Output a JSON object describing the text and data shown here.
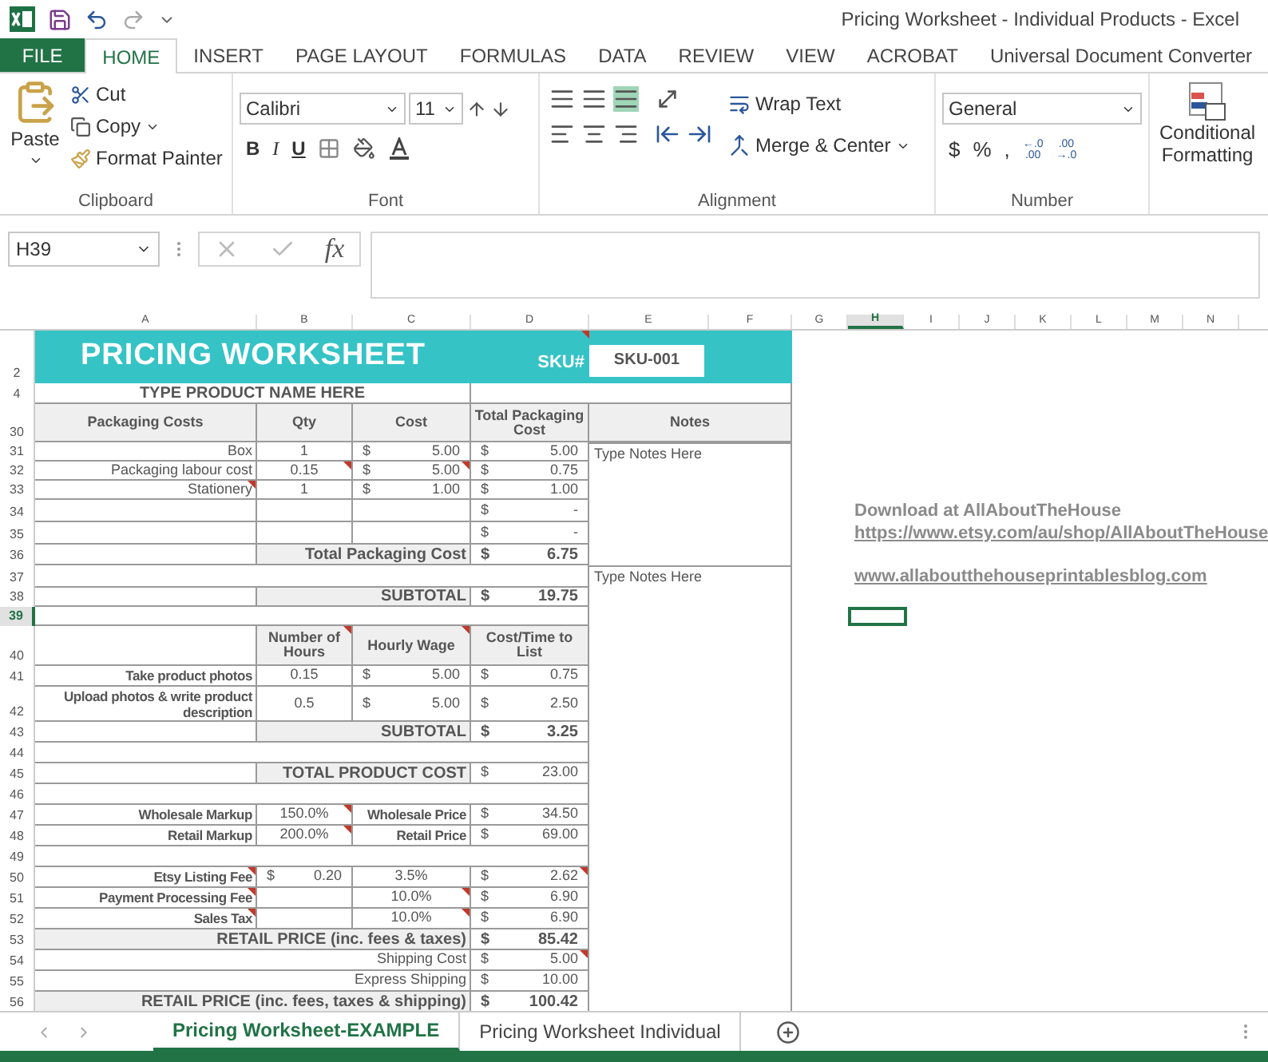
{
  "window": {
    "title": "Pricing Worksheet - Individual Products - Excel"
  },
  "ribbon_tabs": [
    {
      "label": "FILE",
      "kind": "file",
      "selected": false
    },
    {
      "label": "HOME",
      "kind": "tab",
      "selected": true
    },
    {
      "label": "INSERT",
      "kind": "tab",
      "selected": false
    },
    {
      "label": "PAGE LAYOUT",
      "kind": "tab",
      "selected": false
    },
    {
      "label": "FORMULAS",
      "kind": "tab",
      "selected": false
    },
    {
      "label": "DATA",
      "kind": "tab",
      "selected": false
    },
    {
      "label": "REVIEW",
      "kind": "tab",
      "selected": false
    },
    {
      "label": "VIEW",
      "kind": "tab",
      "selected": false
    },
    {
      "label": "ACROBAT",
      "kind": "tab",
      "selected": false
    },
    {
      "label": "Universal Document Converter",
      "kind": "tab",
      "selected": false
    }
  ],
  "clipboard": {
    "paste": "Paste",
    "cut": "Cut",
    "copy": "Copy",
    "format_painter": "Format Painter",
    "group": "Clipboard"
  },
  "font": {
    "name": "Calibri",
    "size": "11",
    "bold": "B",
    "italic": "I",
    "underline": "U",
    "group": "Font"
  },
  "alignment": {
    "wrap_text": "Wrap Text",
    "merge": "Merge & Center",
    "group": "Alignment"
  },
  "number": {
    "format": "General",
    "buttons": [
      "$",
      "%",
      ","
    ],
    "decimals": [
      {
        "top": "←.0",
        "bottom": ".00"
      },
      {
        "top": ".00",
        "bottom": "→.0"
      }
    ],
    "group": "Number"
  },
  "styles": {
    "conditional": "Conditional",
    "formatting": "Formatting"
  },
  "formula_bar": {
    "name_box": "H39",
    "fx": "fx"
  },
  "columns": [
    {
      "label": "A",
      "selected": false
    },
    {
      "label": "B",
      "selected": false
    },
    {
      "label": "C",
      "selected": false
    },
    {
      "label": "D",
      "selected": false
    },
    {
      "label": "E",
      "selected": false
    },
    {
      "label": "F",
      "selected": false
    },
    {
      "label": "G",
      "selected": false
    },
    {
      "label": "H",
      "selected": true
    },
    {
      "label": "I",
      "selected": false
    },
    {
      "label": "J",
      "selected": false
    },
    {
      "label": "K",
      "selected": false
    },
    {
      "label": "L",
      "selected": false
    },
    {
      "label": "M",
      "selected": false
    },
    {
      "label": "N",
      "selected": false
    }
  ],
  "rows": [
    {
      "num": "2",
      "selected": false,
      "cells": [
        {
          "kind": "title",
          "text": "PRICING WORKSHEET"
        },
        {
          "kind": "sku-label",
          "text": "SKU#",
          "comment": true
        },
        {
          "kind": "sku-box",
          "text": "SKU-001"
        },
        {
          "kind": "band"
        }
      ]
    },
    {
      "num": "4",
      "selected": false,
      "cells": [
        {
          "kind": "product",
          "text": "TYPE PRODUCT NAME HERE"
        },
        {
          "kind": "blank"
        }
      ]
    },
    {
      "num": "30",
      "selected": false,
      "cells": [
        {
          "kind": "header",
          "text": "Packaging Costs"
        },
        {
          "kind": "header",
          "text": "Qty"
        },
        {
          "kind": "header",
          "text": "Cost"
        },
        {
          "kind": "header",
          "text": "Total Packaging Cost"
        },
        {
          "kind": "header",
          "text": "Notes"
        }
      ]
    },
    {
      "num": "31",
      "selected": false,
      "cells": [
        {
          "kind": "label",
          "text": "Box"
        },
        {
          "kind": "value",
          "text": "1"
        },
        {
          "kind": "money",
          "dollar": "$",
          "text": "5.00"
        },
        {
          "kind": "money",
          "dollar": "$",
          "text": "5.00"
        },
        {
          "kind": "note",
          "text": "Type Notes Here"
        }
      ]
    },
    {
      "num": "32",
      "selected": false,
      "cells": [
        {
          "kind": "label",
          "text": "Packaging labour cost"
        },
        {
          "kind": "value",
          "text": "0.15",
          "comment": true
        },
        {
          "kind": "money",
          "dollar": "$",
          "text": "5.00",
          "comment": true
        },
        {
          "kind": "money",
          "dollar": "$",
          "text": "0.75"
        },
        {
          "kind": "notes-empty"
        }
      ]
    },
    {
      "num": "33",
      "selected": false,
      "cells": [
        {
          "kind": "label",
          "text": "Stationery",
          "comment": true
        },
        {
          "kind": "value",
          "text": "1"
        },
        {
          "kind": "money",
          "dollar": "$",
          "text": "1.00"
        },
        {
          "kind": "money",
          "dollar": "$",
          "text": "1.00"
        },
        {
          "kind": "notes-empty"
        }
      ]
    },
    {
      "num": "34",
      "selected": false,
      "side": {
        "kind": "text",
        "text": "Download at AllAboutTheHouse"
      },
      "cells": [
        {
          "kind": "blank"
        },
        {
          "kind": "blank"
        },
        {
          "kind": "blank"
        },
        {
          "kind": "money",
          "dollar": "$",
          "text": "-"
        },
        {
          "kind": "notes-empty"
        }
      ]
    },
    {
      "num": "35",
      "selected": false,
      "side": {
        "kind": "link",
        "text": "https://www.etsy.com/au/shop/AllAboutTheHouse"
      },
      "cells": [
        {
          "kind": "blank"
        },
        {
          "kind": "blank"
        },
        {
          "kind": "blank"
        },
        {
          "kind": "money",
          "dollar": "$",
          "text": "-"
        },
        {
          "kind": "notes-empty"
        }
      ]
    },
    {
      "num": "36",
      "selected": false,
      "cells": [
        {
          "kind": "blank"
        },
        {
          "kind": "total",
          "text": "Total Packaging Cost"
        },
        {
          "kind": "money-bold",
          "dollar": "$",
          "text": "6.75"
        },
        {
          "kind": "notes-empty"
        }
      ]
    },
    {
      "num": "37",
      "selected": false,
      "side": {
        "kind": "link",
        "text": "www.allaboutthehouseprintablesblog.com"
      },
      "cells": [
        {
          "kind": "blank"
        },
        {
          "kind": "note",
          "text": "Type Notes Here"
        }
      ]
    },
    {
      "num": "38",
      "selected": false,
      "cells": [
        {
          "kind": "blank"
        },
        {
          "kind": "total",
          "text": "SUBTOTAL"
        },
        {
          "kind": "money-bold",
          "dollar": "$",
          "text": "19.75"
        },
        {
          "kind": "notes-empty"
        }
      ]
    },
    {
      "num": "39",
      "selected": true,
      "cells": [
        {
          "kind": "blank"
        },
        {
          "kind": "notes-empty"
        }
      ]
    },
    {
      "num": "40",
      "selected": false,
      "cells": [
        {
          "kind": "blank"
        },
        {
          "kind": "header",
          "text": "Number of Hours",
          "comment": true
        },
        {
          "kind": "header",
          "text": "Hourly Wage",
          "comment": true
        },
        {
          "kind": "header",
          "text": "Cost/Time to List"
        },
        {
          "kind": "notes-empty"
        }
      ]
    },
    {
      "num": "41",
      "selected": false,
      "cells": [
        {
          "kind": "bold-label",
          "text": "Take product photos"
        },
        {
          "kind": "value",
          "text": "0.15"
        },
        {
          "kind": "money",
          "dollar": "$",
          "text": "5.00"
        },
        {
          "kind": "money",
          "dollar": "$",
          "text": "0.75"
        },
        {
          "kind": "notes-empty"
        }
      ]
    },
    {
      "num": "42",
      "selected": false,
      "cells": [
        {
          "kind": "bold-label",
          "text": "Upload photos & write product description"
        },
        {
          "kind": "value",
          "text": "0.5"
        },
        {
          "kind": "money",
          "dollar": "$",
          "text": "5.00"
        },
        {
          "kind": "money",
          "dollar": "$",
          "text": "2.50"
        },
        {
          "kind": "notes-empty"
        }
      ]
    },
    {
      "num": "43",
      "selected": false,
      "cells": [
        {
          "kind": "blank"
        },
        {
          "kind": "total",
          "text": "SUBTOTAL"
        },
        {
          "kind": "money-bold",
          "dollar": "$",
          "text": "3.25"
        },
        {
          "kind": "notes-empty"
        }
      ]
    },
    {
      "num": "44",
      "selected": false,
      "cells": [
        {
          "kind": "blank"
        },
        {
          "kind": "notes-empty"
        }
      ]
    },
    {
      "num": "45",
      "selected": false,
      "cells": [
        {
          "kind": "blank"
        },
        {
          "kind": "total",
          "text": "TOTAL PRODUCT COST"
        },
        {
          "kind": "money",
          "dollar": "$",
          "text": "23.00"
        },
        {
          "kind": "notes-empty"
        }
      ]
    },
    {
      "num": "46",
      "selected": false,
      "cells": [
        {
          "kind": "blank"
        },
        {
          "kind": "notes-empty"
        }
      ]
    },
    {
      "num": "47",
      "selected": false,
      "cells": [
        {
          "kind": "bold-label",
          "text": "Wholesale Markup"
        },
        {
          "kind": "value",
          "text": "150.0%",
          "comment": true
        },
        {
          "kind": "bold-label",
          "text": "Wholesale Price"
        },
        {
          "kind": "money",
          "dollar": "$",
          "text": "34.50"
        },
        {
          "kind": "notes-empty"
        }
      ]
    },
    {
      "num": "48",
      "selected": false,
      "cells": [
        {
          "kind": "bold-label",
          "text": "Retail Markup"
        },
        {
          "kind": "value",
          "text": "200.0%",
          "comment": true
        },
        {
          "kind": "bold-label",
          "text": "Retail Price"
        },
        {
          "kind": "money",
          "dollar": "$",
          "text": "69.00"
        },
        {
          "kind": "notes-empty"
        }
      ]
    },
    {
      "num": "49",
      "selected": false,
      "cells": [
        {
          "kind": "blank"
        },
        {
          "kind": "notes-empty"
        }
      ]
    },
    {
      "num": "50",
      "selected": false,
      "cells": [
        {
          "kind": "bold-label",
          "text": "Etsy Listing Fee",
          "comment": true
        },
        {
          "kind": "money",
          "dollar": "$",
          "text": "0.20"
        },
        {
          "kind": "value",
          "text": "3.5%"
        },
        {
          "kind": "money",
          "dollar": "$",
          "text": "2.62",
          "comment": true
        },
        {
          "kind": "notes-empty"
        }
      ]
    },
    {
      "num": "51",
      "selected": false,
      "cells": [
        {
          "kind": "bold-label",
          "text": "Payment Processing Fee",
          "comment": true
        },
        {
          "kind": "blank"
        },
        {
          "kind": "value",
          "text": "10.0%",
          "comment": true
        },
        {
          "kind": "money",
          "dollar": "$",
          "text": "6.90"
        },
        {
          "kind": "notes-empty"
        }
      ]
    },
    {
      "num": "52",
      "selected": false,
      "cells": [
        {
          "kind": "bold-label",
          "text": "Sales Tax",
          "comment": true
        },
        {
          "kind": "blank"
        },
        {
          "kind": "value",
          "text": "10.0%",
          "comment": true
        },
        {
          "kind": "money",
          "dollar": "$",
          "text": "6.90"
        },
        {
          "kind": "notes-empty"
        }
      ]
    },
    {
      "num": "53",
      "selected": false,
      "cells": [
        {
          "kind": "total",
          "text": "RETAIL PRICE (inc. fees & taxes)"
        },
        {
          "kind": "money-bold",
          "dollar": "$",
          "text": "85.42"
        },
        {
          "kind": "notes-empty"
        }
      ]
    },
    {
      "num": "54",
      "selected": false,
      "cells": [
        {
          "kind": "label",
          "text": "Shipping Cost"
        },
        {
          "kind": "money",
          "dollar": "$",
          "text": "5.00",
          "comment": true
        },
        {
          "kind": "notes-empty"
        }
      ]
    },
    {
      "num": "55",
      "selected": false,
      "cells": [
        {
          "kind": "label",
          "text": "Express Shipping"
        },
        {
          "kind": "money",
          "dollar": "$",
          "text": "10.00"
        },
        {
          "kind": "notes-empty"
        }
      ]
    },
    {
      "num": "56",
      "selected": false,
      "cells": [
        {
          "kind": "total",
          "text": "RETAIL PRICE (inc. fees, taxes & shipping)"
        },
        {
          "kind": "money-bold",
          "dollar": "$",
          "text": "100.42"
        },
        {
          "kind": "notes-empty"
        }
      ]
    }
  ],
  "sheet_tabs": [
    {
      "label": "Pricing Worksheet-EXAMPLE",
      "selected": true
    },
    {
      "label": "Pricing Worksheet Individual",
      "selected": false
    }
  ]
}
